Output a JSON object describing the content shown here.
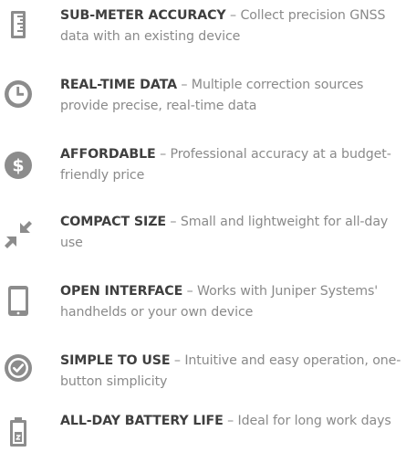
{
  "colors": {
    "icon": "#8c8c8c",
    "title": "#3f3f3f",
    "body": "#8a8a8a",
    "background": "#ffffff"
  },
  "features": [
    {
      "icon": "ruler-icon",
      "title": "SUB-METER ACCURACY",
      "separator": " – ",
      "description": "Collect precision GNSS data with an existing device"
    },
    {
      "icon": "clock-icon",
      "title": "REAL-TIME DATA",
      "separator": " – ",
      "description": "Multiple correction sources provide precise, real-time data"
    },
    {
      "icon": "dollar-icon",
      "title": "AFFORDABLE",
      "separator": " – ",
      "description": "Professional accuracy at a budget-friendly price"
    },
    {
      "icon": "compress-arrows-icon",
      "title": "COMPACT SIZE",
      "separator": " – ",
      "description": "Small and lightweight for all-day use"
    },
    {
      "icon": "phone-device-icon",
      "title": "OPEN INTERFACE",
      "separator": " – ",
      "description": "Works with Juniper Systems' handhelds or your own device"
    },
    {
      "icon": "checkmark-circle-icon",
      "title": "SIMPLE TO USE",
      "separator": " – ",
      "description": "Intuitive and easy operation, one-button simplicity"
    },
    {
      "icon": "battery-icon",
      "title": "ALL-DAY BATTERY LIFE",
      "separator": " – ",
      "description": "Ideal for long work days"
    }
  ]
}
